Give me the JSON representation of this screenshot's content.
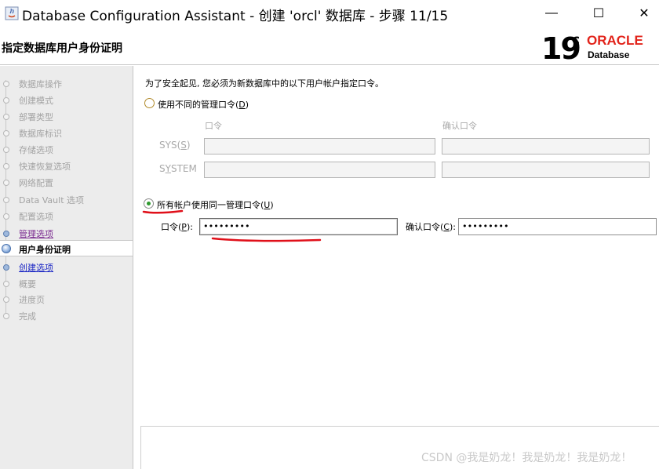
{
  "window": {
    "title": "Database Configuration Assistant - 创建 'orcl' 数据库 - 步骤 11/15",
    "minimize": "—",
    "maximize": "☐",
    "close": "✕"
  },
  "header": {
    "page_title": "指定数据库用户身份证明",
    "logo_version": "19",
    "logo_suffix": "c",
    "logo_brand": "ORACLE",
    "logo_product": "Database"
  },
  "sidebar": {
    "steps": [
      {
        "label": "数据库操作",
        "state": "disabled"
      },
      {
        "label": "创建模式",
        "state": "disabled"
      },
      {
        "label": "部署类型",
        "state": "disabled"
      },
      {
        "label": "数据库标识",
        "state": "disabled"
      },
      {
        "label": "存储选项",
        "state": "disabled"
      },
      {
        "label": "快速恢复选项",
        "state": "disabled"
      },
      {
        "label": "网络配置",
        "state": "disabled"
      },
      {
        "label": "Data Vault 选项",
        "state": "disabled"
      },
      {
        "label": "配置选项",
        "state": "disabled"
      },
      {
        "label": "管理选项",
        "state": "visited"
      },
      {
        "label": "用户身份证明",
        "state": "current"
      },
      {
        "label": "创建选项",
        "state": "link"
      },
      {
        "label": "概要",
        "state": "disabled"
      },
      {
        "label": "进度页",
        "state": "disabled"
      },
      {
        "label": "完成",
        "state": "disabled"
      }
    ]
  },
  "main": {
    "intro": "为了安全起见, 您必须为新数据库中的以下用户帐户指定口令。",
    "option_different": {
      "label": "使用不同的管理口令(",
      "mnemonic": "D",
      "suffix": ")",
      "selected": false
    },
    "columns": {
      "password": "口令",
      "confirm": "确认口令"
    },
    "rows": [
      {
        "label_pre": "SYS(",
        "mnemonic": "S",
        "label_post": ")"
      },
      {
        "label_pre": "S",
        "mnemonic": "Y",
        "label_post": "STEM"
      }
    ],
    "option_same": {
      "label": "所有帐户使用同一管理口令(",
      "mnemonic": "U",
      "suffix": ")",
      "selected": true
    },
    "password": {
      "label_pre": "口令(",
      "mnemonic": "P",
      "label_post": "):",
      "value": "•••••••••"
    },
    "confirm_password": {
      "label_pre": "确认口令(",
      "mnemonic": "C",
      "label_post": "):",
      "value": "•••••••••"
    }
  },
  "watermark": "CSDN @我是奶龙！我是奶龙！我是奶龙！",
  "colors": {
    "oracle_red": "#e2231a",
    "annotation_red": "#e0101a",
    "link_blue": "#1b26c4",
    "visited_purple": "#7a2a8f",
    "radio_green": "#2f9a2f"
  }
}
